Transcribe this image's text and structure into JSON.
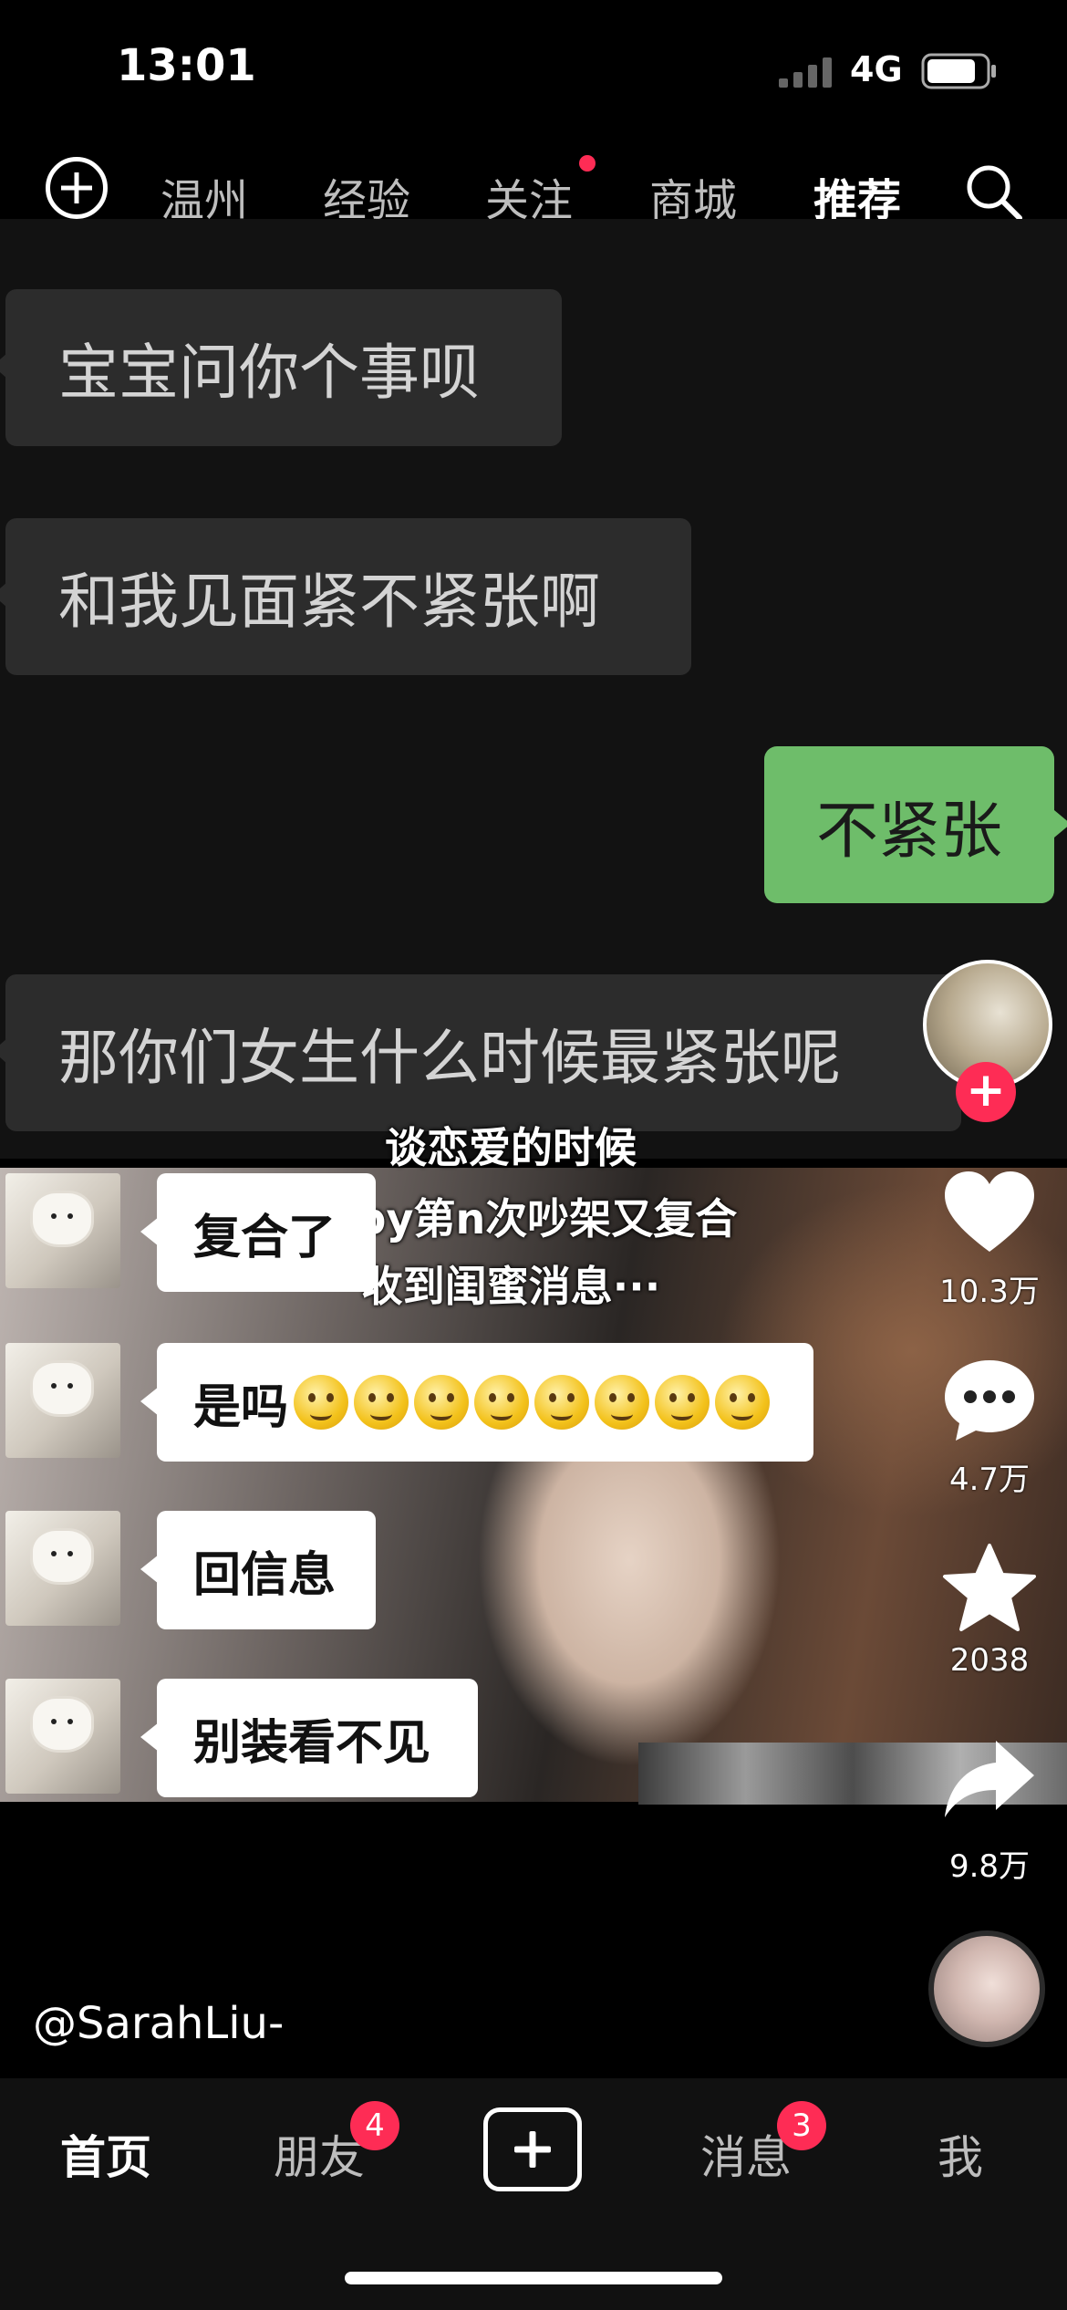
{
  "status_bar": {
    "time": "13:01",
    "network": "4G"
  },
  "top_nav": {
    "tabs": [
      {
        "label": "温州"
      },
      {
        "label": "经验"
      },
      {
        "label": "关注"
      },
      {
        "label": "商城"
      },
      {
        "label": "推荐"
      }
    ],
    "active_tab": "推荐"
  },
  "video": {
    "chat_top": [
      {
        "text": "宝宝问你个事呗",
        "side": "left"
      },
      {
        "text": "和我见面紧不紧张啊",
        "side": "left"
      },
      {
        "text": "不紧张",
        "side": "right"
      },
      {
        "text": "那你们女生什么时候最紧张呢",
        "side": "left"
      }
    ],
    "captions": [
      "谈恋爱的时候",
      "和npy第n次吵架又复合",
      "收到闺蜜消息···"
    ],
    "chat_bottom": [
      {
        "text": "复合了",
        "emoji_count": 0
      },
      {
        "text": "是吗",
        "emoji_count": 8
      },
      {
        "text": "回信息",
        "emoji_count": 0
      },
      {
        "text": "别装看不见",
        "emoji_count": 0
      }
    ],
    "username": "@SarahLiu-"
  },
  "actions": {
    "like_count": "10.3万",
    "comment_count": "4.7万",
    "favorite_count": "2038",
    "share_count": "9.8万",
    "follow_symbol": "+"
  },
  "bottom_nav": {
    "items": [
      {
        "label": "首页"
      },
      {
        "label": "朋友",
        "badge": "4"
      },
      {
        "label": "消息",
        "badge": "3"
      },
      {
        "label": "我"
      }
    ],
    "active_item": "首页"
  },
  "colors": {
    "accent": "#fe2c55",
    "chat_green": "#6ebd6a",
    "chat_gray": "#2c2c2c"
  }
}
